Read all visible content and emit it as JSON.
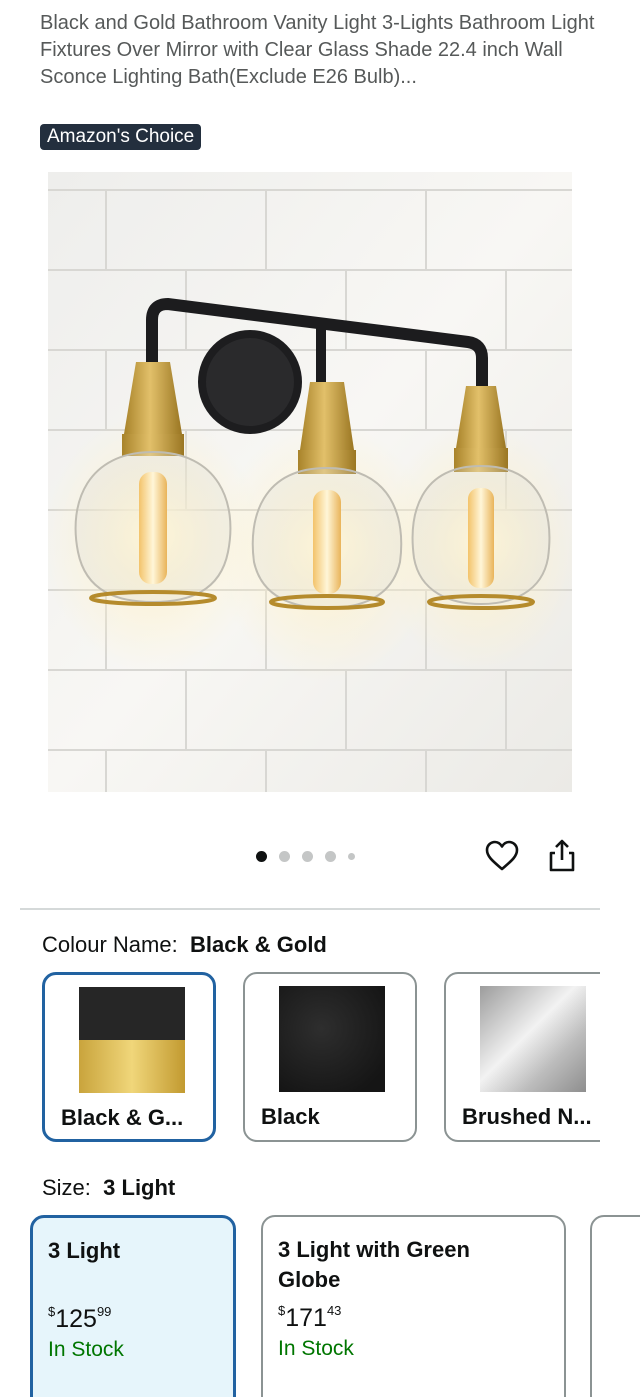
{
  "product": {
    "title": "Black and Gold Bathroom Vanity Light 3-Lights Bathroom Light Fixtures Over Mirror with Clear Glass Shade 22.4 inch Wall Sconce Lighting Bath(Exclude E26 Bulb)...",
    "badge": "Amazon's Choice"
  },
  "gallery": {
    "image_count": 5,
    "active_index": 0
  },
  "actions": {
    "icons": [
      "heart-icon",
      "share-icon"
    ]
  },
  "colour": {
    "label": "Colour Name:",
    "selected": "Black & Gold",
    "options": [
      {
        "name": "Black & G..."
      },
      {
        "name": "Black"
      },
      {
        "name": "Brushed N..."
      }
    ]
  },
  "size": {
    "label": "Size:",
    "selected": "3 Light",
    "options": [
      {
        "name": "3 Light",
        "price_symbol": "$",
        "price_whole": "125",
        "price_fraction": "99",
        "stock": "In Stock"
      },
      {
        "name": "3 Light with Green Globe",
        "price_symbol": "$",
        "price_whole": "171",
        "price_fraction": "43",
        "stock": "In Stock"
      }
    ]
  },
  "colors": {
    "selected_border": "#2162a1",
    "badge_bg": "#232f3e",
    "in_stock": "#007600"
  }
}
